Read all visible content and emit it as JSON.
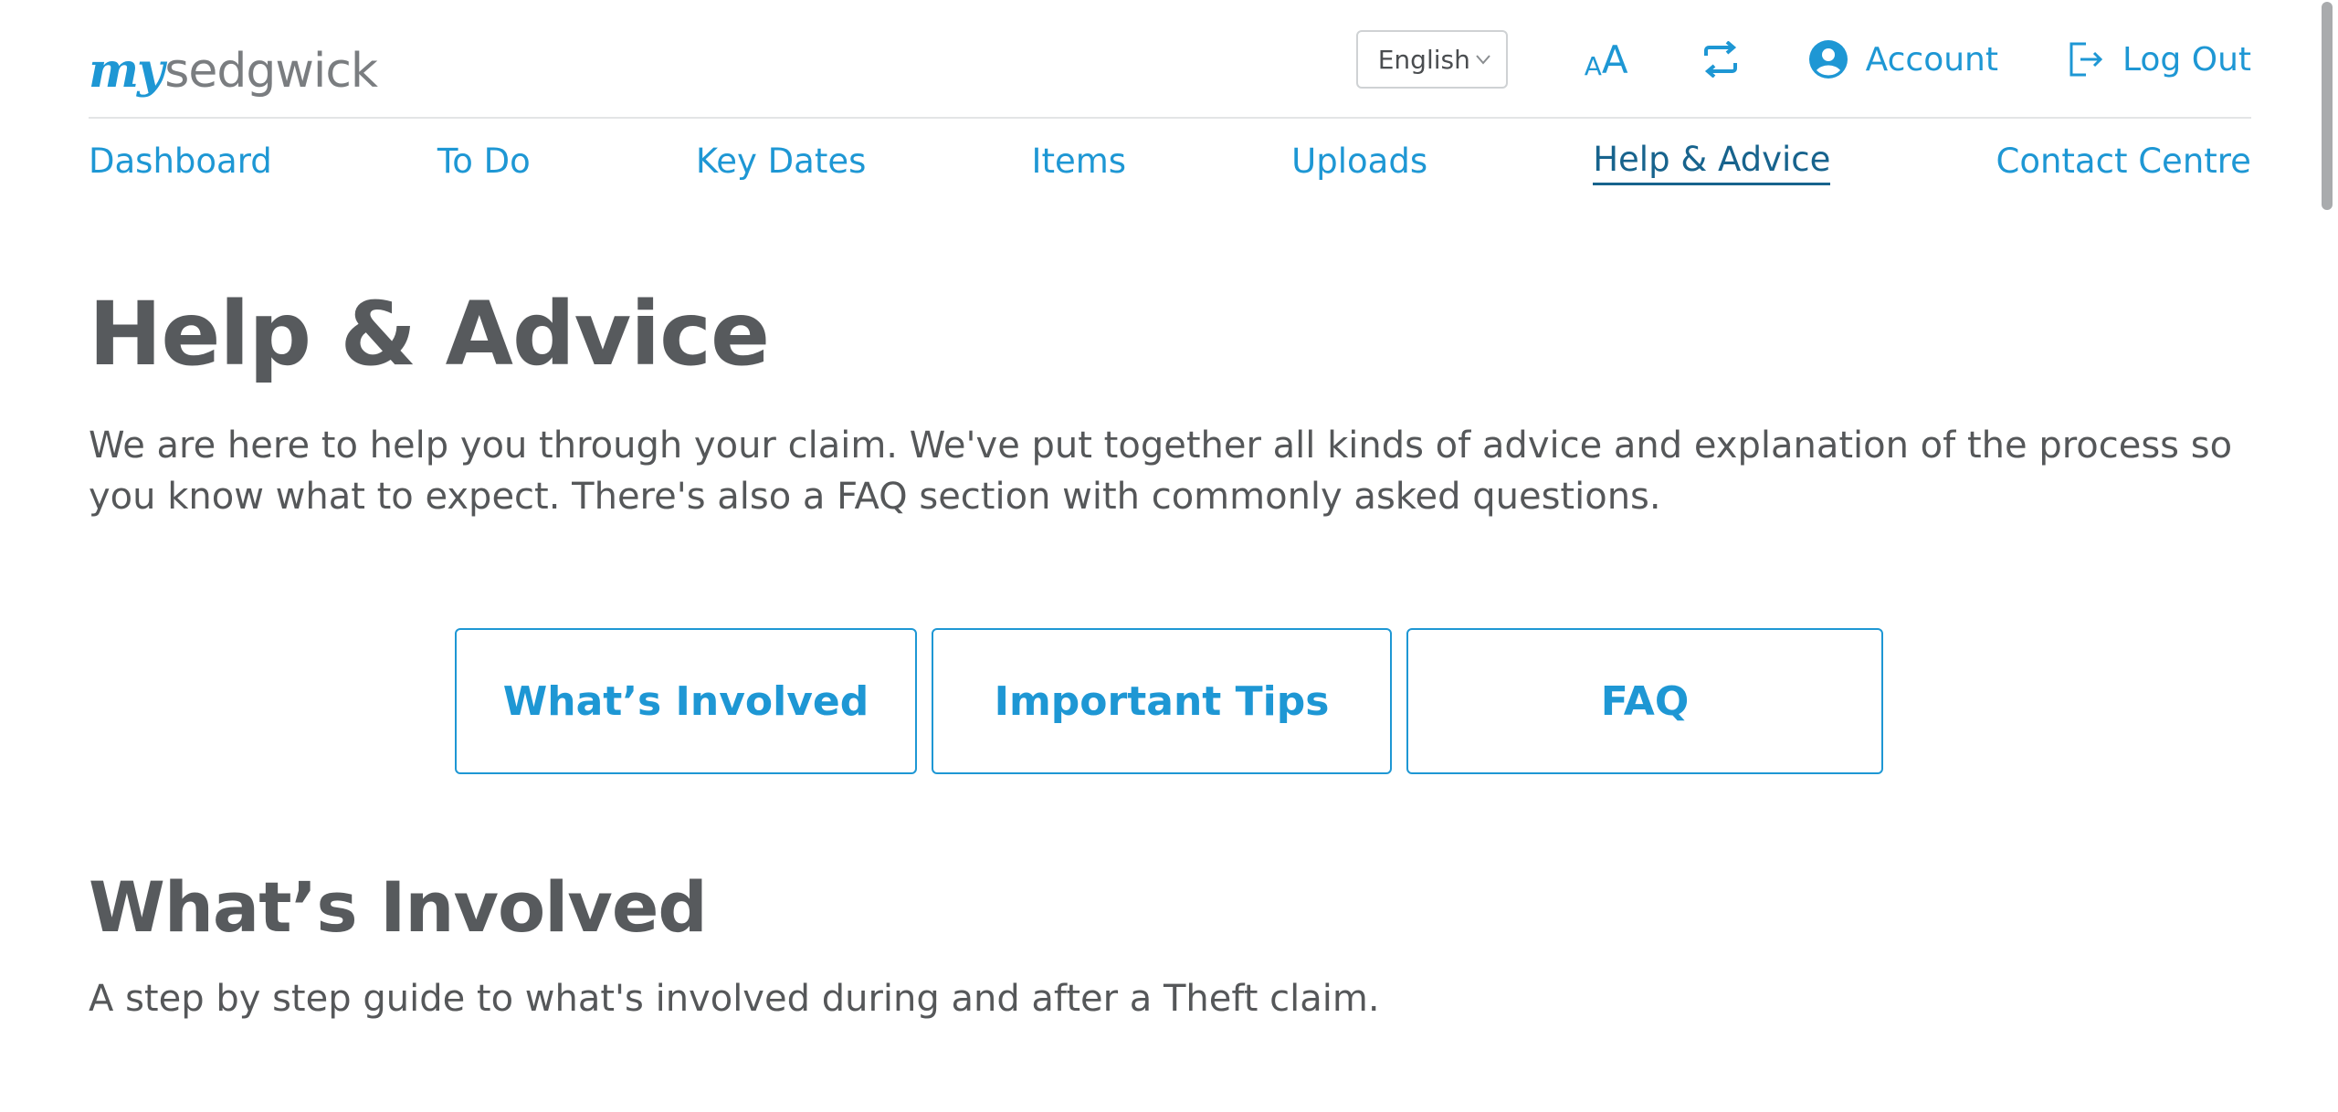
{
  "brand": {
    "logo_prefix": "my",
    "logo_name": "sedgwick",
    "accent_color": "#1e97d4",
    "active_nav_color": "#17638d"
  },
  "header": {
    "language": {
      "selected": "English"
    },
    "font_size_toggle": {
      "small_glyph": "A",
      "large_glyph": "A",
      "icon": "text-size-icon"
    },
    "switch_claim": {
      "icon": "switch-icon"
    },
    "account_label": "Account",
    "account_icon": "user-circle-icon",
    "logout_label": "Log Out",
    "logout_icon": "logout-icon"
  },
  "nav": {
    "items": [
      {
        "label": "Dashboard"
      },
      {
        "label": "To Do"
      },
      {
        "label": "Key Dates"
      },
      {
        "label": "Items"
      },
      {
        "label": "Uploads"
      },
      {
        "label": "Help & Advice",
        "active": true
      },
      {
        "label": "Contact Centre"
      }
    ]
  },
  "main": {
    "title": "Help & Advice",
    "intro": "We are here to help you through your claim. We've put together all kinds of advice and explanation of the process so you know what to expect. There's also a FAQ section with commonly asked questions.",
    "section_buttons": [
      {
        "label": "What’s Involved"
      },
      {
        "label": "Important Tips"
      },
      {
        "label": "FAQ"
      }
    ],
    "section": {
      "heading": "What’s Involved",
      "description": "A step by step guide to what's involved during and after a Theft claim."
    }
  }
}
